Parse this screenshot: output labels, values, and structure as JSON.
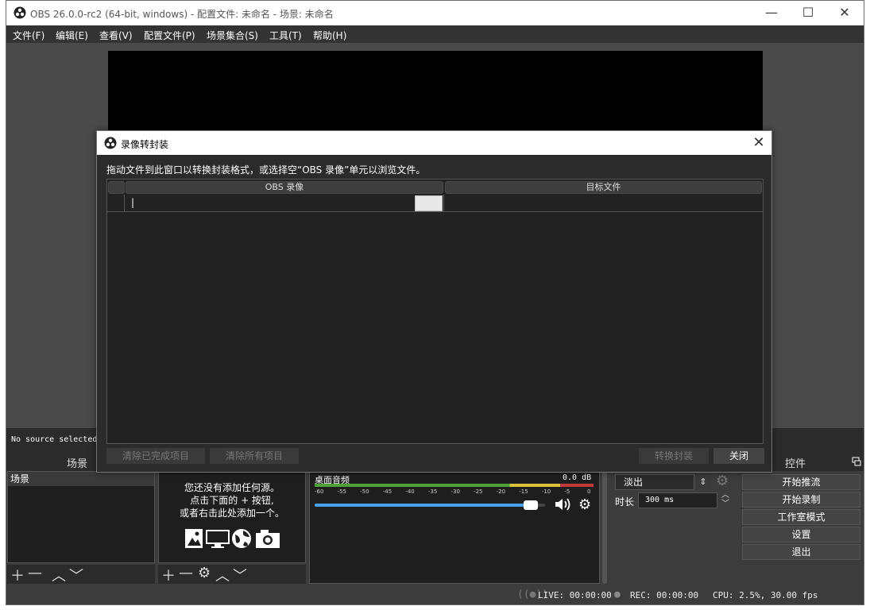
{
  "window": {
    "title": "OBS 26.0.0-rc2 (64-bit, windows) - 配置文件: 未命名 - 场景: 未命名",
    "minimize": "—",
    "maximize": "☐",
    "close": "✕"
  },
  "menu": [
    {
      "label": "文件(F)"
    },
    {
      "label": "编辑(E)"
    },
    {
      "label": "查看(V)"
    },
    {
      "label": "配置文件(P)"
    },
    {
      "label": "场景集合(S)"
    },
    {
      "label": "工具(T)"
    },
    {
      "label": "帮助(H)"
    }
  ],
  "source_bar": {
    "text": "No source selected"
  },
  "docks": {
    "scenes": {
      "title": "场景",
      "items": [
        "场景"
      ]
    },
    "sources": {
      "empty_lines": [
        "您还没有添加任何源。",
        "点击下面的 + 按钮,",
        "或者右击此处添加一个。"
      ]
    },
    "mixer": {
      "track": "桌面音频",
      "level": "0.0 dB",
      "ticks": [
        "-60",
        "-55",
        "-50",
        "-45",
        "-40",
        "-35",
        "-30",
        "-25",
        "-20",
        "-15",
        "-10",
        "-5",
        "0"
      ],
      "volume": 0.97
    },
    "transitions": {
      "transition": "淡出",
      "duration_label": "时长",
      "duration": "300 ms"
    },
    "controls": {
      "title": "控件",
      "buttons": [
        "开始推流",
        "开始录制",
        "工作室模式",
        "设置",
        "退出"
      ]
    }
  },
  "status": {
    "live": "LIVE: 00:00:00",
    "rec": "REC: 00:00:00",
    "cpu": "CPU: 2.5%, 30.00 fps"
  },
  "dialog": {
    "title": "录像转封装",
    "description": "拖动文件到此窗口以转换封装格式，或选择空“OBS 录像”单元以浏览文件。",
    "columns": [
      "OBS 录像",
      "目标文件"
    ],
    "buttons": {
      "clear_finished": "清除已完成项目",
      "clear_all": "清除所有项目",
      "remux": "转换封装",
      "close": "关闭"
    }
  },
  "colors": {
    "meter_green": "#4ea03a",
    "meter_yellow": "#d6c33a",
    "meter_red": "#c03a3a",
    "volume_blue": "#4aa0e8"
  }
}
